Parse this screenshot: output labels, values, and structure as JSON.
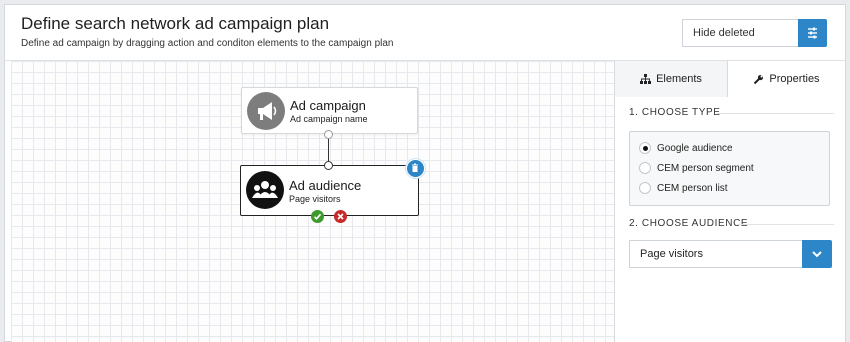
{
  "header": {
    "title": "Define search network ad campaign plan",
    "subtitle": "Define ad campaign by dragging action and conditon elements to the campaign plan",
    "hide_deleted_label": "Hide deleted"
  },
  "canvas": {
    "nodes": [
      {
        "title": "Ad campaign",
        "subtitle": "Ad campaign name",
        "icon": "megaphone-icon"
      },
      {
        "title": "Ad audience",
        "subtitle": "Page visitors",
        "icon": "people-group-icon"
      }
    ]
  },
  "panel": {
    "tabs": [
      {
        "label": "Elements",
        "icon": "sitemap-icon",
        "active": false
      },
      {
        "label": "Properties",
        "icon": "wrench-icon",
        "active": true
      }
    ],
    "choose_type_label": "1. CHOOSE TYPE",
    "type_options": [
      {
        "label": "Google audience",
        "checked": true
      },
      {
        "label": "CEM person segment",
        "checked": false
      },
      {
        "label": "CEM person list",
        "checked": false
      }
    ],
    "choose_audience_label": "2. CHOOSE AUDIENCE",
    "audience_selected": "Page visitors"
  },
  "colors": {
    "accent": "#2c86c8",
    "confirm": "#3f9a2e",
    "cancel": "#c62a2a"
  }
}
